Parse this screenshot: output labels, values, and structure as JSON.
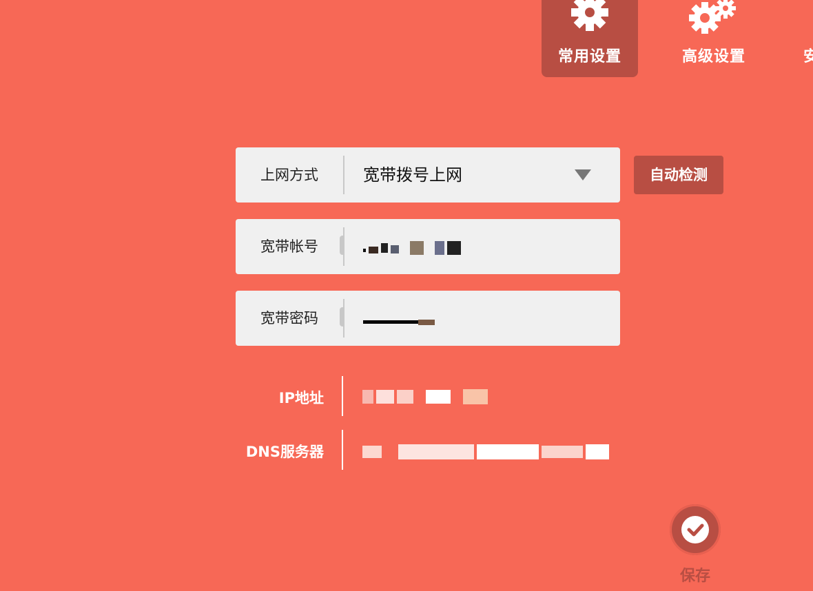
{
  "tabs": [
    {
      "label": "常用设置",
      "icon": "gear-icon",
      "active": true
    },
    {
      "label": "高级设置",
      "icon": "gears-icon",
      "active": false
    },
    {
      "label": "安",
      "icon": "",
      "active": false
    }
  ],
  "form": {
    "connection_type": {
      "label": "上网方式",
      "value": "宽带拨号上网"
    },
    "detect_button": "自动检测",
    "account": {
      "label": "宽带帐号",
      "value": ""
    },
    "password": {
      "label": "宽带密码",
      "value": ""
    }
  },
  "info": {
    "ip": {
      "label": "IP地址",
      "value": ""
    },
    "dns": {
      "label": "DNS服务器",
      "value": ""
    }
  },
  "save": {
    "label": "保存"
  },
  "colors": {
    "background": "#f76856",
    "accent_dark": "#b84e43",
    "field_bg": "#f0f0f0"
  }
}
